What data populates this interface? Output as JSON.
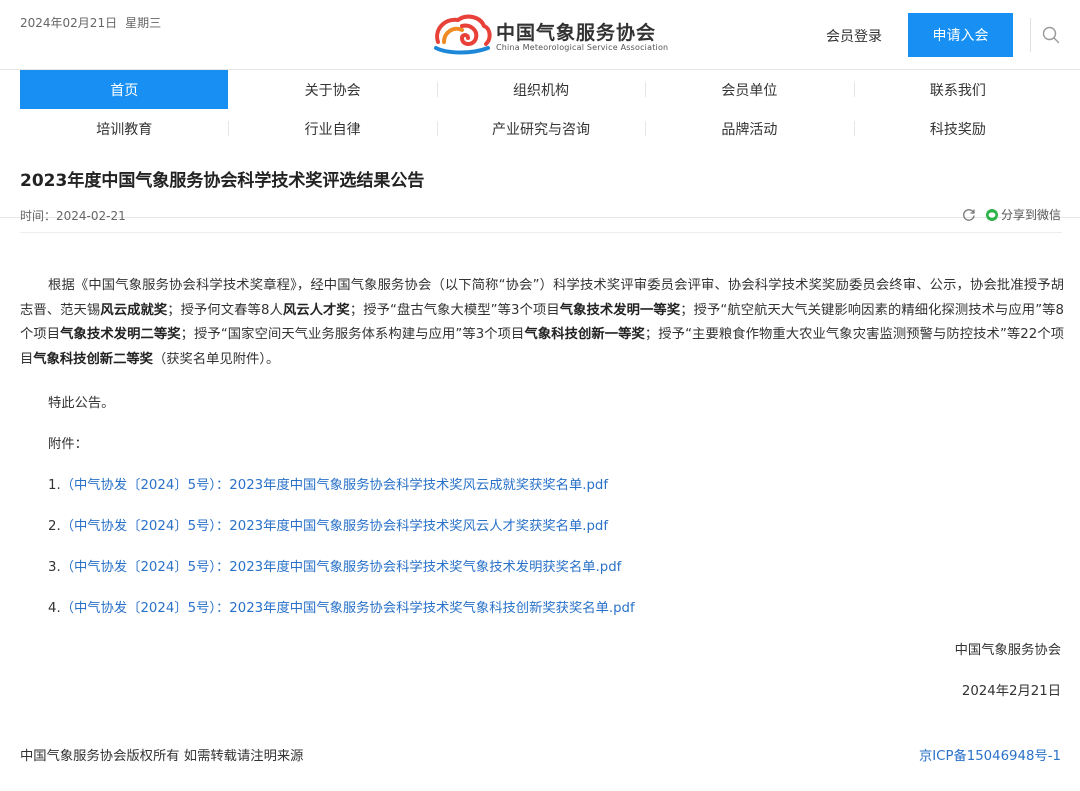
{
  "header": {
    "date": "2024年02月21日",
    "weekday": "星期三",
    "logo_cn": "中国气象服务协会",
    "logo_en": "China Meteorological Service Association",
    "login_label": "会员登录",
    "join_label": "申请入会",
    "accent_color": "#1890f3"
  },
  "nav": {
    "row1": [
      "首页",
      "关于协会",
      "组织机构",
      "会员单位",
      "联系我们"
    ],
    "row2": [
      "培训教育",
      "行业自律",
      "产业研究与咨询",
      "品牌活动",
      "科技奖励"
    ]
  },
  "article": {
    "title": "2023年度中国气象服务协会科学技术奖评选结果公告",
    "time_label": "时间：",
    "time": "2024-02-21",
    "share_label": "分享到微信",
    "para": [
      {
        "t": "根据《中国气象服务协会科学技术奖章程》，经中国气象服务协会（以下简称“协会”）科学技术奖评审委员会评审、协会科学技术奖奖励委员会终审、公示，协会批准授予胡志晋、范天锡",
        "b": false
      },
      {
        "t": "风云成就奖",
        "b": true
      },
      {
        "t": "；授予何文春等8人",
        "b": false
      },
      {
        "t": "风云人才奖",
        "b": true
      },
      {
        "t": "；授予“盘古气象大模型”等3个项目",
        "b": false
      },
      {
        "t": "气象技术发明一等奖",
        "b": true
      },
      {
        "t": "；授予“航空航天大气关键影响因素的精细化探测技术与应用”等8个项目",
        "b": false
      },
      {
        "t": "气象技术发明二等奖",
        "b": true
      },
      {
        "t": "；授予“国家空间天气业务服务体系构建与应用”等3个项目",
        "b": false
      },
      {
        "t": "气象科技创新一等奖",
        "b": true
      },
      {
        "t": "；授予“主要粮食作物重大农业气象灾害监测预警与防控技术”等22个项目",
        "b": false
      },
      {
        "t": "气象科技创新二等奖",
        "b": true
      },
      {
        "t": "（获奖名单见附件）。",
        "b": false
      }
    ],
    "notice": "特此公告。",
    "attachments_label": "附件：",
    "attachments": [
      {
        "num": "1.",
        "text": "（中气协发〔2024〕5号）：2023年度中国气象服务协会科学技术奖风云成就奖获奖名单.pdf"
      },
      {
        "num": "2.",
        "text": "（中气协发〔2024〕5号）：2023年度中国气象服务协会科学技术奖风云人才奖获奖名单.pdf"
      },
      {
        "num": "3.",
        "text": "（中气协发〔2024〕5号）：2023年度中国气象服务协会科学技术奖气象技术发明获奖名单.pdf"
      },
      {
        "num": "4.",
        "text": "（中气协发〔2024〕5号）：2023年度中国气象服务协会科学技术奖气象科技创新奖获奖名单.pdf"
      }
    ],
    "signature_org": "中国气象服务协会",
    "signature_date": "2024年2月21日"
  },
  "footer": {
    "copyright": "中国气象服务协会版权所有 如需转载请注明来源",
    "icp": "京ICP备15046948号-1",
    "link_color": "#2a72c8"
  },
  "icons": {
    "logo": "cma-logo-icon",
    "search": "search-icon",
    "refresh": "refresh-icon",
    "wechat": "wechat-icon"
  }
}
